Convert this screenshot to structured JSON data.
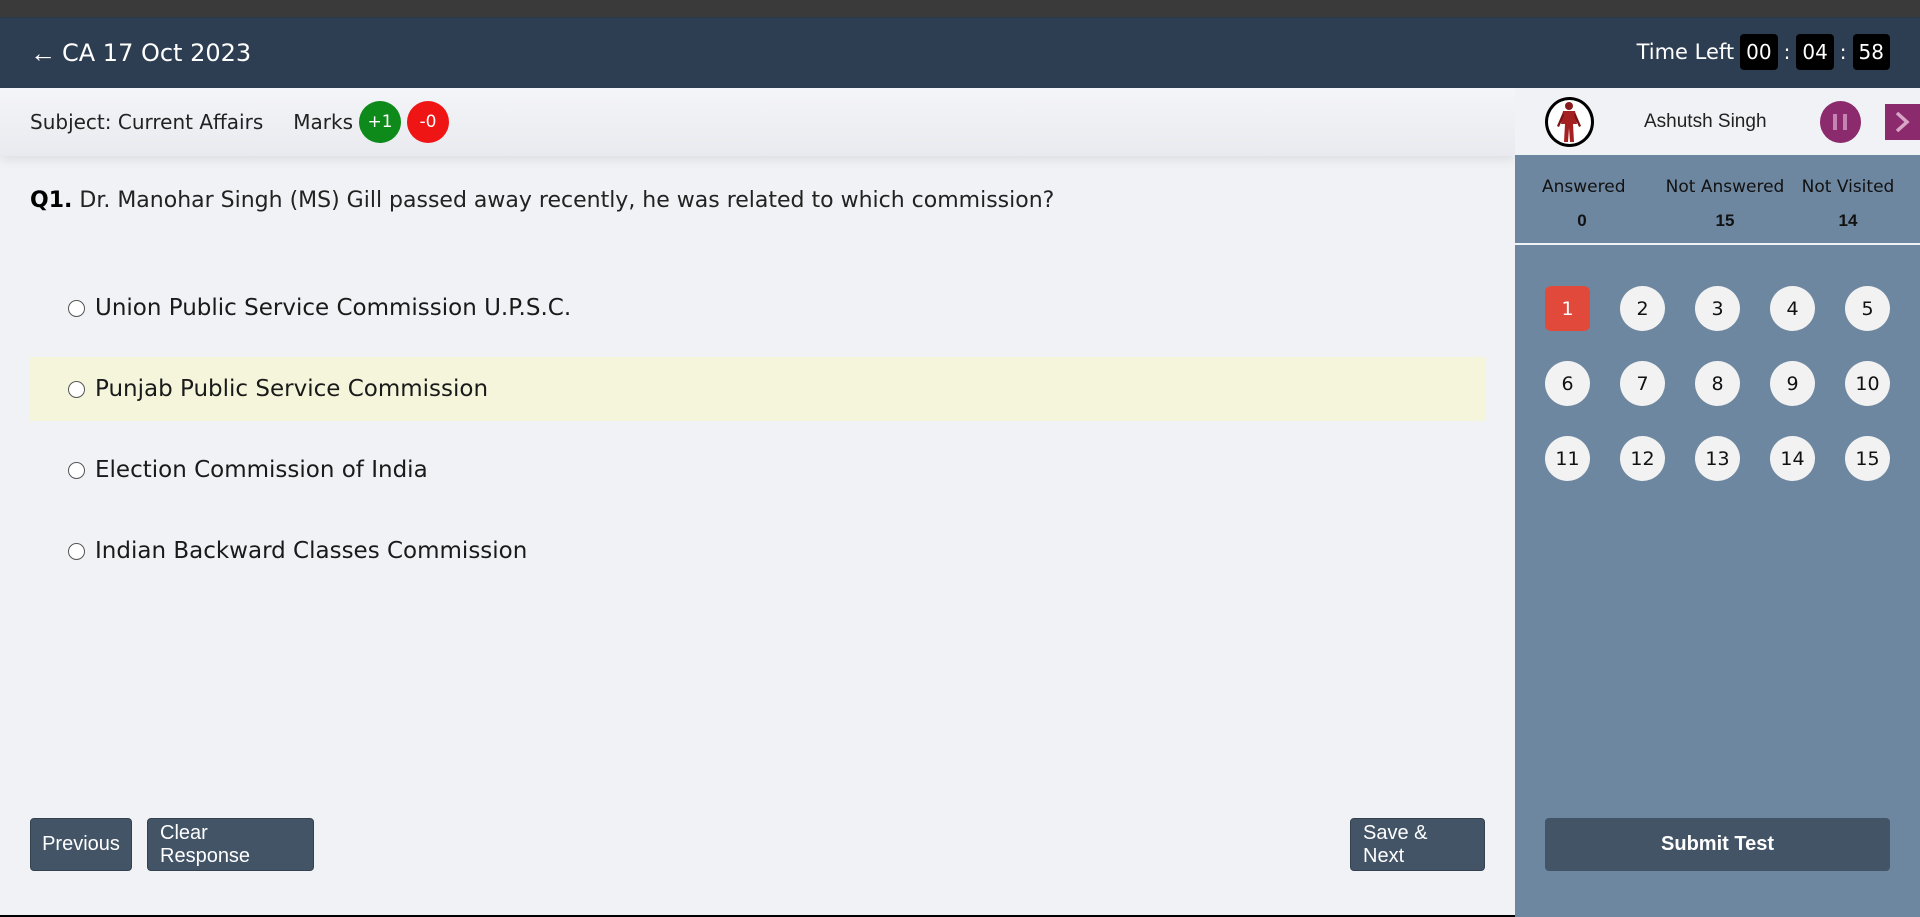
{
  "header": {
    "back_icon": "←",
    "title": "CA 17 Oct 2023",
    "time_left_label": "Time Left",
    "timer": {
      "hours": "00",
      "minutes": "04",
      "seconds": "58",
      "separator": ":"
    }
  },
  "subbar": {
    "subject": "Subject: Current Affairs",
    "marks_label": "Marks",
    "positive": "+1",
    "negative": "-0",
    "colors": {
      "positive": "#0d8a1a",
      "negative": "#f01515"
    }
  },
  "question": {
    "number": "Q1.",
    "text": "Dr. Manohar Singh (MS) Gill passed away recently, he was related to which commission?",
    "options": [
      {
        "label": "Union Public Service Commission U.P.S.C.",
        "highlighted": false
      },
      {
        "label": "Punjab Public Service Commission",
        "highlighted": true
      },
      {
        "label": "Election Commission of India",
        "highlighted": false
      },
      {
        "label": "Indian Backward Classes Commission",
        "highlighted": false
      }
    ]
  },
  "footer": {
    "previous": "Previous",
    "clear": "Clear Response",
    "save_next": "Save & Next"
  },
  "sidebar": {
    "user_name": "Ashutsh Singh",
    "stats": {
      "answered_label": "Answered",
      "answered": "0",
      "not_answered_label": "Not Answered",
      "not_answered": "15",
      "not_visited_label": "Not Visited",
      "not_visited": "14"
    },
    "questions": [
      "1",
      "2",
      "3",
      "4",
      "5",
      "6",
      "7",
      "8",
      "9",
      "10",
      "11",
      "12",
      "13",
      "14",
      "15"
    ],
    "active_question": "1",
    "submit": "Submit Test",
    "icons": {
      "pause": "pause-icon",
      "next": "chevron-right-icon",
      "avatar": "avatar-icon"
    },
    "colors": {
      "accent": "#8b2a6c",
      "active_question": "#e14a3b",
      "panel": "#6e87a0"
    }
  }
}
